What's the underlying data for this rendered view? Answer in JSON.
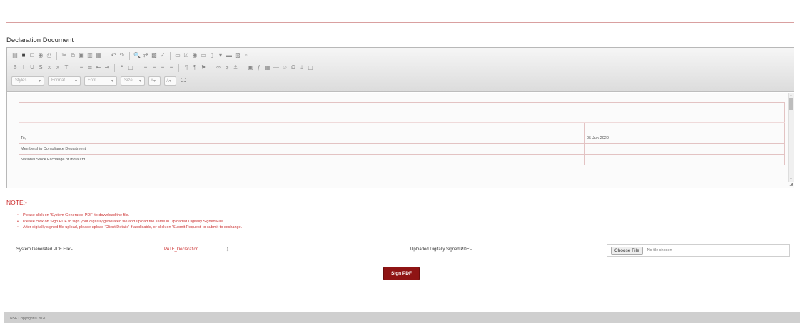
{
  "page": {
    "section_title": "Declaration Document"
  },
  "editor": {
    "toolbar": {
      "row1": [
        "source-icon",
        "save-icon",
        "new-page-icon",
        "preview-icon",
        "print-icon",
        "cut-icon",
        "copy-icon",
        "paste-icon",
        "paste-text-icon",
        "paste-word-icon",
        "undo-icon",
        "redo-icon",
        "find-icon",
        "replace-icon",
        "select-all-icon",
        "spellcheck-icon",
        "form-icon",
        "checkbox-icon",
        "radio-icon",
        "textfield-icon",
        "textarea-icon",
        "select-icon",
        "button-icon",
        "image-button-icon",
        "hidden-field-icon"
      ],
      "row2": [
        "bold-icon",
        "italic-icon",
        "underline-icon",
        "strike-icon",
        "subscript-icon",
        "superscript-icon",
        "remove-format-icon",
        "numbered-list-icon",
        "bulleted-list-icon",
        "outdent-icon",
        "indent-icon",
        "blockquote-icon",
        "div-icon",
        "align-left-icon",
        "align-center-icon",
        "align-right-icon",
        "justify-icon",
        "ltr-icon",
        "rtl-icon",
        "language-icon",
        "link-icon",
        "unlink-icon",
        "anchor-icon",
        "image-icon",
        "flash-icon",
        "table-icon",
        "hr-icon",
        "smiley-icon",
        "special-char-icon",
        "pagebreak-icon",
        "iframe-icon"
      ],
      "combos": [
        "Styles",
        "Format",
        "Font",
        "Size"
      ],
      "combo_arrow": "▾",
      "color_buttons": [
        "A▾",
        "A▾"
      ],
      "maximize_glyph": "⛶"
    },
    "scroll_up": "▲",
    "scroll_down": "▼",
    "resize_grip": "◢",
    "document": {
      "salutation": "To,",
      "date": "05-Jun-2020",
      "line1": "Membership Compliance Department",
      "line2": "National Stock Exchange of India Ltd."
    }
  },
  "note": {
    "heading": "NOTE:-",
    "items": [
      "Please click on 'System Generated PDF' to download the file.",
      "Please click on Sign PDF to sign your digitally generated file and upload the same in Uploaded Digitally Signed File.",
      "After digitally signed file upload, please upload 'Client Details' if applicable, or click on 'Submit Request' to submit to exchange."
    ]
  },
  "form": {
    "system_pdf_label": "System Generated PDF File:-",
    "system_pdf_value": "PATF_Declaration",
    "download_glyph": "⇩",
    "upload_label": "Uploaded Digitally Signed PDF:-",
    "choose_file": "Choose File",
    "no_file": "No file chosen",
    "sign_button": "Sign PDF"
  },
  "footer": {
    "text": "NSE Copyright © 2020"
  }
}
